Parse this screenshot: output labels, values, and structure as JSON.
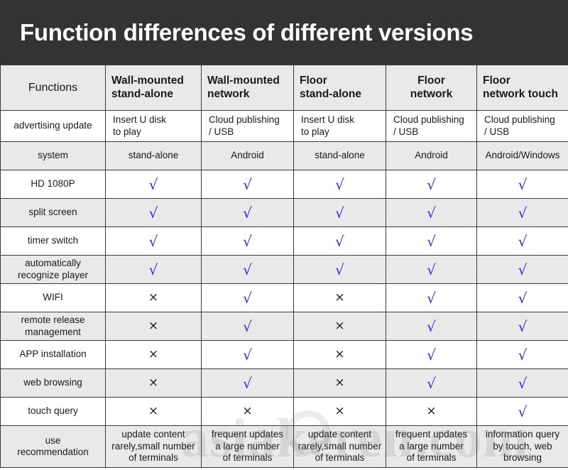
{
  "banner": {
    "title": "Function differences of different versions",
    "bg_color": "#333333",
    "text_color": "#ffffff"
  },
  "colors": {
    "check": "#3a2fd0",
    "cross": "#1c1c1c",
    "shade_row": "#e9e9e9",
    "plain_row": "#ffffff",
    "border": "#3a3a3a"
  },
  "watermark": {
    "text": "asiakeren.com"
  },
  "table": {
    "columns": [
      {
        "label": "Functions"
      },
      {
        "label": "Wall-mounted stand-alone",
        "line1": "Wall-mounted",
        "line2": "stand-alone",
        "align": "left"
      },
      {
        "label": "Wall-mounted network",
        "line1": "Wall-mounted",
        "line2": "network",
        "align": "left"
      },
      {
        "label": "Floor stand-alone",
        "line1": "Floor",
        "line2": "stand-alone",
        "align": "left"
      },
      {
        "label": "Floor network",
        "line1": "Floor",
        "line2": "network",
        "align": "center"
      },
      {
        "label": "Floor network touch",
        "line1": "Floor",
        "line2": "network touch",
        "align": "left"
      }
    ],
    "rows": [
      {
        "feature": "advertising update",
        "type": "text",
        "shaded": false,
        "values": [
          "Insert U disk to play",
          "Cloud publishing / USB",
          "Insert U disk to play",
          "Cloud publishing / USB",
          "Cloud publishing / USB"
        ],
        "value_lines": [
          [
            "Insert U disk",
            "to play"
          ],
          [
            "Cloud publishing",
            "/ USB"
          ],
          [
            "Insert U disk",
            "to play"
          ],
          [
            "Cloud publishing",
            "/ USB"
          ],
          [
            "Cloud publishing",
            "/ USB"
          ]
        ]
      },
      {
        "feature": "system",
        "type": "text",
        "shaded": true,
        "values": [
          "stand-alone",
          "Android",
          "stand-alone",
          "Android",
          "Android/Windows"
        ],
        "value_lines": [
          [
            "stand-alone"
          ],
          [
            "Android"
          ],
          [
            "stand-alone"
          ],
          [
            "Android"
          ],
          [
            "Android/Windows"
          ]
        ]
      },
      {
        "feature": "HD 1080P",
        "type": "mark",
        "shaded": false,
        "values": [
          "check",
          "check",
          "check",
          "check",
          "check"
        ]
      },
      {
        "feature": "split screen",
        "type": "mark",
        "shaded": true,
        "values": [
          "check",
          "check",
          "check",
          "check",
          "check"
        ]
      },
      {
        "feature": "timer switch",
        "type": "mark",
        "shaded": false,
        "values": [
          "check",
          "check",
          "check",
          "check",
          "check"
        ]
      },
      {
        "feature": "automatically recognize player",
        "feature_lines": [
          "automatically",
          "recognize player"
        ],
        "type": "mark",
        "shaded": true,
        "values": [
          "check",
          "check",
          "check",
          "check",
          "check"
        ]
      },
      {
        "feature": "WIFI",
        "type": "mark",
        "shaded": false,
        "values": [
          "cross",
          "check",
          "cross",
          "check",
          "check"
        ]
      },
      {
        "feature": "remote release management",
        "feature_lines": [
          "remote release",
          "management"
        ],
        "type": "mark",
        "shaded": true,
        "values": [
          "cross",
          "check",
          "cross",
          "check",
          "check"
        ]
      },
      {
        "feature": "APP installation",
        "type": "mark",
        "shaded": false,
        "values": [
          "cross",
          "check",
          "cross",
          "check",
          "check"
        ]
      },
      {
        "feature": "web browsing",
        "type": "mark",
        "shaded": true,
        "values": [
          "cross",
          "check",
          "cross",
          "check",
          "check"
        ]
      },
      {
        "feature": "touch query",
        "type": "mark",
        "shaded": false,
        "values": [
          "cross",
          "cross",
          "cross",
          "cross",
          "check"
        ]
      },
      {
        "feature": "use recommendation",
        "feature_lines": [
          "use",
          "recommendation"
        ],
        "type": "text",
        "shaded": true,
        "values": [
          "update content rarely,small number of terminals",
          "frequent updates a large number of terminals",
          "update content rarely,small number of terminals",
          "frequent updates a large number of terminals",
          "information query by touch, web browsing"
        ],
        "value_lines": [
          [
            "update content",
            "rarely,small number",
            "of terminals"
          ],
          [
            "frequent updates",
            "a large number",
            "of terminals"
          ],
          [
            "update content",
            "rarely,small number",
            "of terminals"
          ],
          [
            "frequent updates",
            "a large number",
            "of terminals"
          ],
          [
            "information query",
            "by touch, web",
            "browsing"
          ]
        ]
      }
    ]
  },
  "glyphs": {
    "check": "√",
    "cross": "×"
  }
}
